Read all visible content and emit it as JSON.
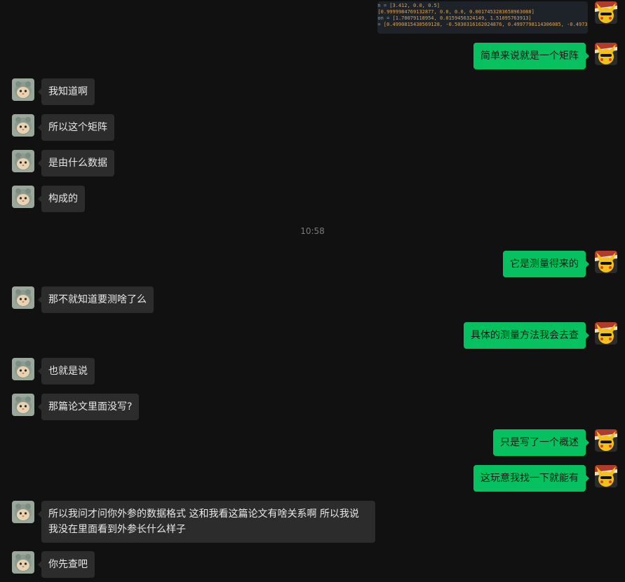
{
  "code_image": {
    "lines": [
      {
        "prefix": "ion = ",
        "values": "[3.412, 0.0, 0.5]"
      },
      {
        "prefix": " = ",
        "values": "[0.9999984769132877, 0.0, 0.0, 0.0017453283658963088]"
      },
      {
        "prefix": "tion = ",
        "values": "[1.70079118954, 0.0159456324149, 1.51095763913]"
      },
      {
        "prefix": "n = ",
        "values": "[0.4990815430569128, -0.5030316162024876, 0.4997798114306085, -0.49737"
      }
    ]
  },
  "timestamp": "10:58",
  "messages": [
    {
      "text": "简单来说就是一个矩阵"
    },
    {
      "text": "我知道啊"
    },
    {
      "text": "所以这个矩阵"
    },
    {
      "text": "是由什么数据"
    },
    {
      "text": "构成的"
    },
    {
      "text": "它是测量得来的"
    },
    {
      "text": "那不就知道要测啥了么"
    },
    {
      "text": "具体的测量方法我会去查"
    },
    {
      "text": "也就是说"
    },
    {
      "text": "那篇论文里面没写?"
    },
    {
      "text": "只是写了一个概述"
    },
    {
      "text": "这玩意我找一下就能有"
    },
    {
      "text": "所以我问才问你外参的数据格式  这和我看这篇论文有啥关系啊  所以我说我没在里面看到外参长什么样子"
    },
    {
      "text": "你先查吧"
    }
  ],
  "colors": {
    "background": "#111111",
    "incoming_bubble": "#2c2c2c",
    "outgoing_bubble": "#07c160"
  }
}
